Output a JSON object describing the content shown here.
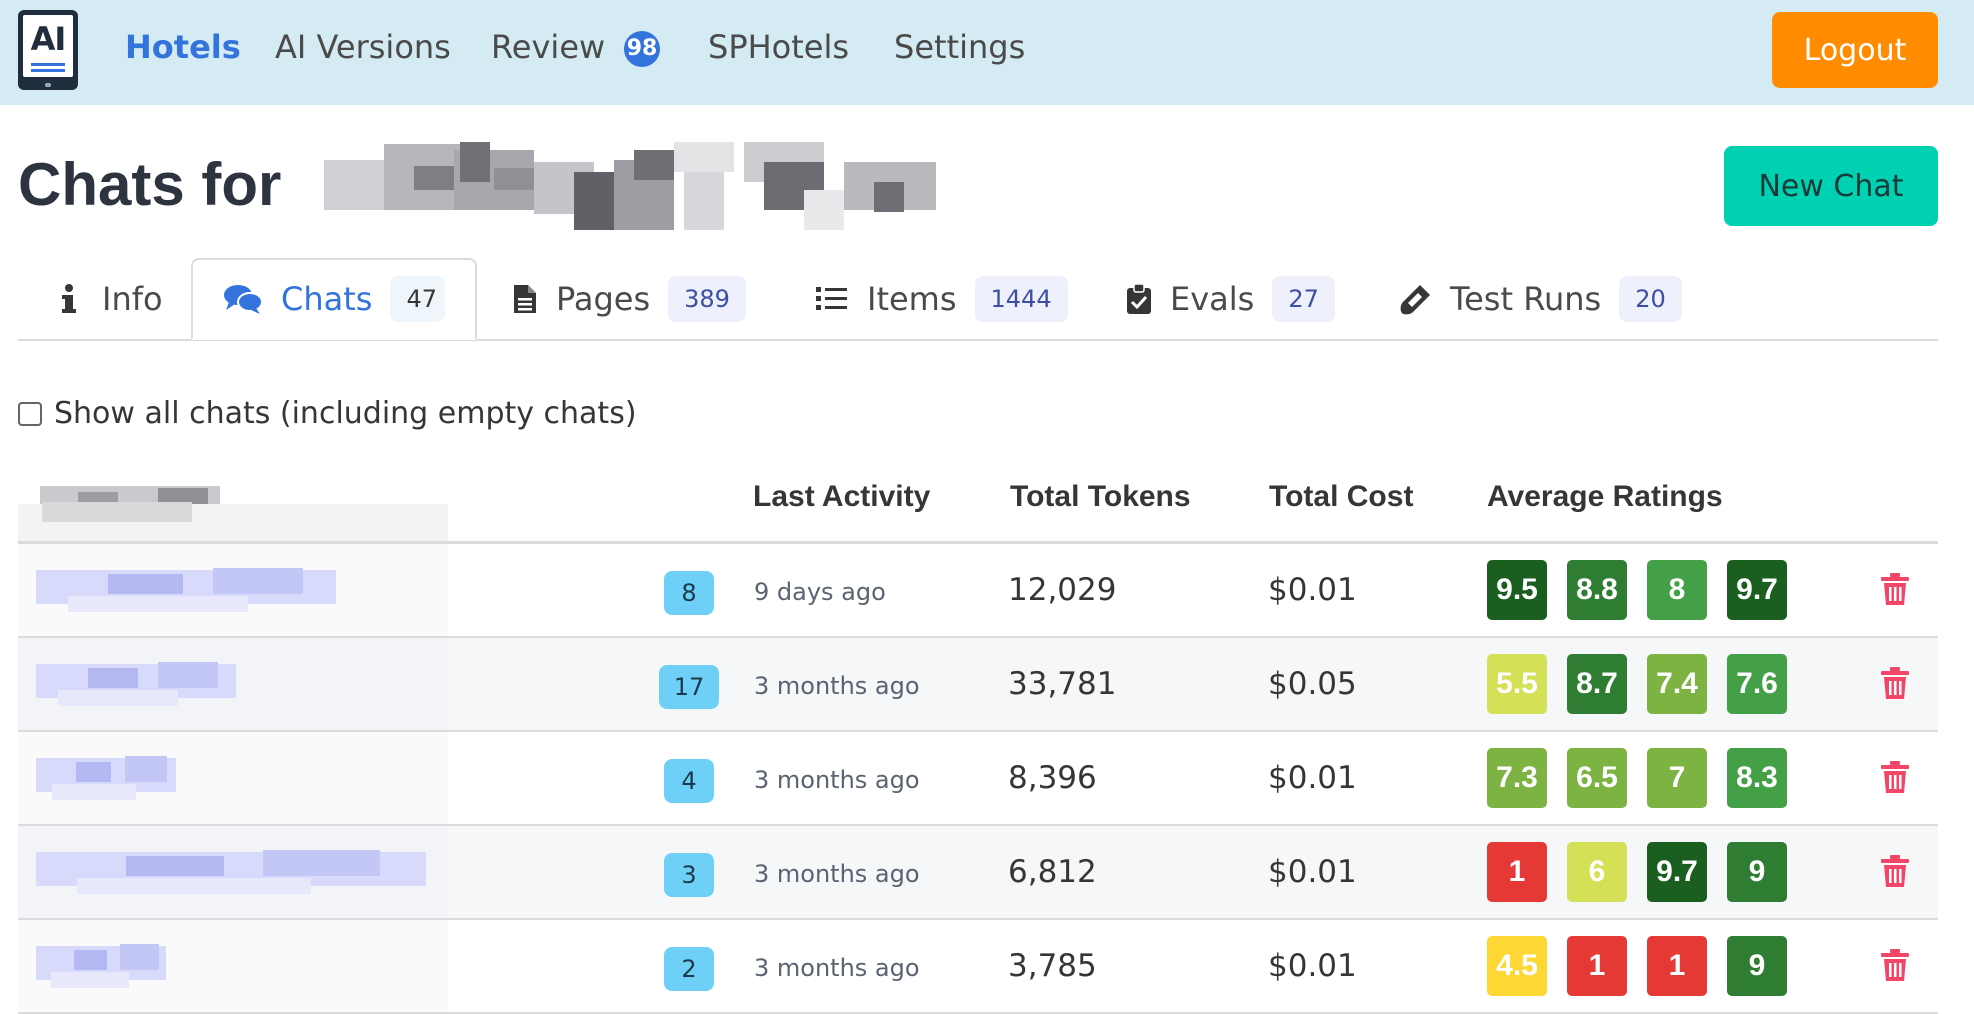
{
  "nav": {
    "logo_text": "AI",
    "items": [
      {
        "label": "Hotels",
        "active": true
      },
      {
        "label": "AI Versions",
        "active": false
      },
      {
        "label": "Review",
        "active": false
      },
      {
        "label": "SPHotels",
        "active": false
      },
      {
        "label": "Settings",
        "active": false
      }
    ],
    "review_badge": "98",
    "logout_label": "Logout"
  },
  "page": {
    "title": "Chats for",
    "new_chat_label": "New Chat"
  },
  "tabs": [
    {
      "label": "Info",
      "icon": "info-icon",
      "count": null,
      "active": false
    },
    {
      "label": "Chats",
      "icon": "comments-icon",
      "count": "47",
      "active": true
    },
    {
      "label": "Pages",
      "icon": "file-icon",
      "count": "389",
      "active": false
    },
    {
      "label": "Items",
      "icon": "list-icon",
      "count": "1444",
      "active": false
    },
    {
      "label": "Evals",
      "icon": "clipboard-check-icon",
      "count": "27",
      "active": false
    },
    {
      "label": "Test Runs",
      "icon": "vial-icon",
      "count": "20",
      "active": false
    }
  ],
  "show_all_label": "Show all chats (including empty chats)",
  "table": {
    "headers": [
      "Last Activity",
      "Total Tokens",
      "Total Cost",
      "Average Ratings"
    ],
    "rows": [
      {
        "count": "8",
        "last_activity": "9 days ago",
        "tokens": "12,029",
        "cost": "$0.01",
        "ratings": [
          "9.5",
          "8.8",
          "8",
          "9.7"
        ]
      },
      {
        "count": "17",
        "last_activity": "3 months ago",
        "tokens": "33,781",
        "cost": "$0.05",
        "ratings": [
          "5.5",
          "8.7",
          "7.4",
          "7.6"
        ]
      },
      {
        "count": "4",
        "last_activity": "3 months ago",
        "tokens": "8,396",
        "cost": "$0.01",
        "ratings": [
          "7.3",
          "6.5",
          "7",
          "8.3"
        ]
      },
      {
        "count": "3",
        "last_activity": "3 months ago",
        "tokens": "6,812",
        "cost": "$0.01",
        "ratings": [
          "1",
          "6",
          "9.7",
          "9"
        ]
      },
      {
        "count": "2",
        "last_activity": "3 months ago",
        "tokens": "3,785",
        "cost": "$0.01",
        "ratings": [
          "4.5",
          "1",
          "1",
          "9"
        ]
      }
    ]
  },
  "colors": {
    "navbar_bg": "#d4ebf3",
    "link_blue": "#3273dc",
    "logout": "#ff8c00",
    "new_chat": "#00d1b2",
    "count_badge": "#6ed0f6",
    "trash": "#f14668"
  }
}
